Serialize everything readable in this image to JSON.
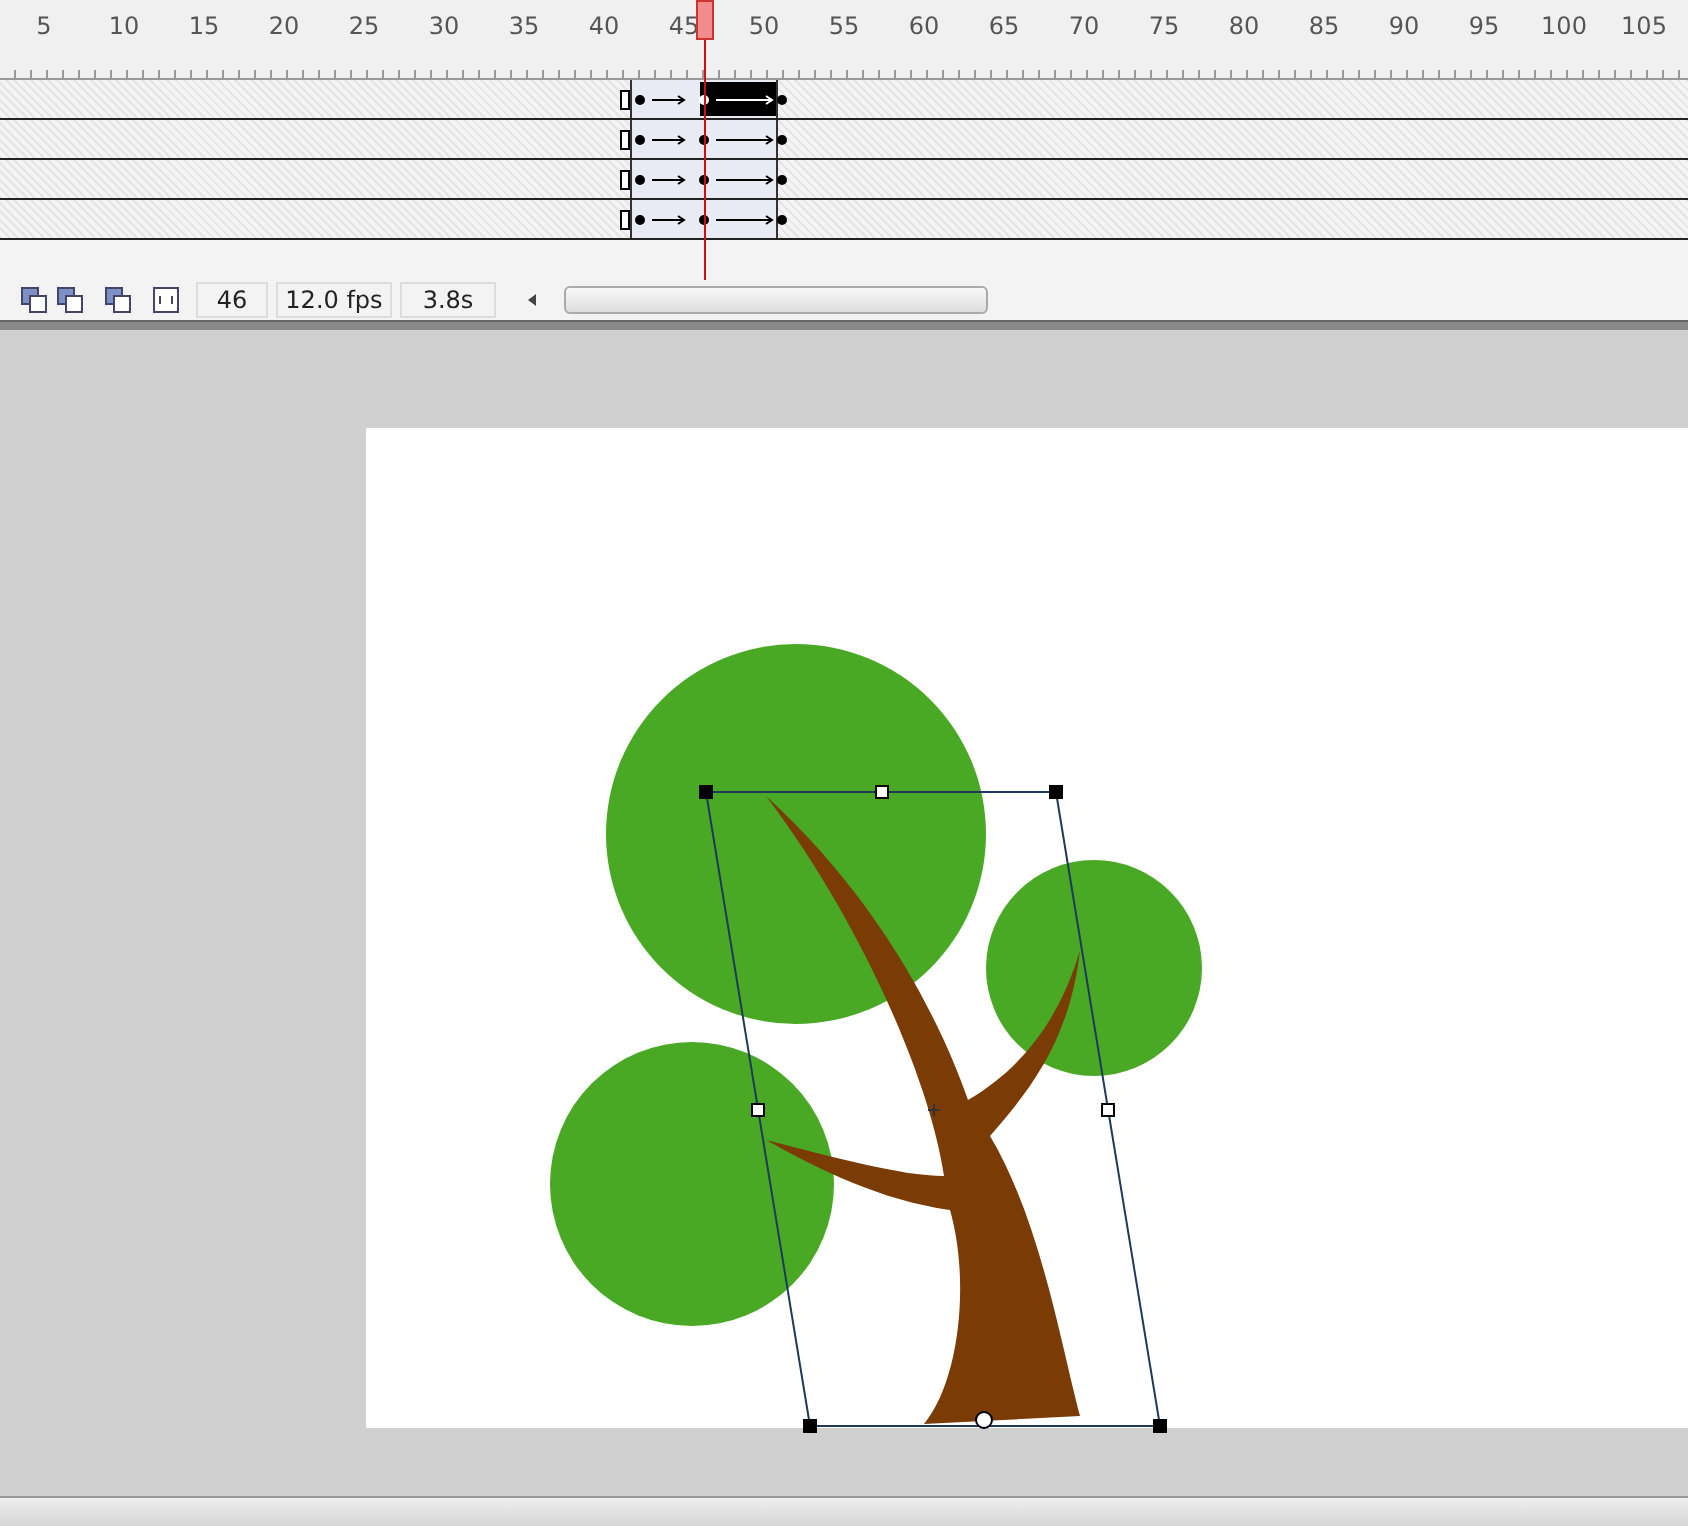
{
  "ruler": {
    "labels": [
      "5",
      "10",
      "15",
      "20",
      "25",
      "30",
      "35",
      "40",
      "45",
      "50",
      "55",
      "60",
      "65",
      "70",
      "75",
      "80",
      "85",
      "90",
      "95",
      "100",
      "105"
    ]
  },
  "layers": [
    {
      "selected": true
    },
    {
      "selected": false
    },
    {
      "selected": false
    },
    {
      "selected": false
    }
  ],
  "status_bar": {
    "current_frame": "46",
    "frame_rate": "12.0 fps",
    "elapsed_time": "3.8s"
  }
}
